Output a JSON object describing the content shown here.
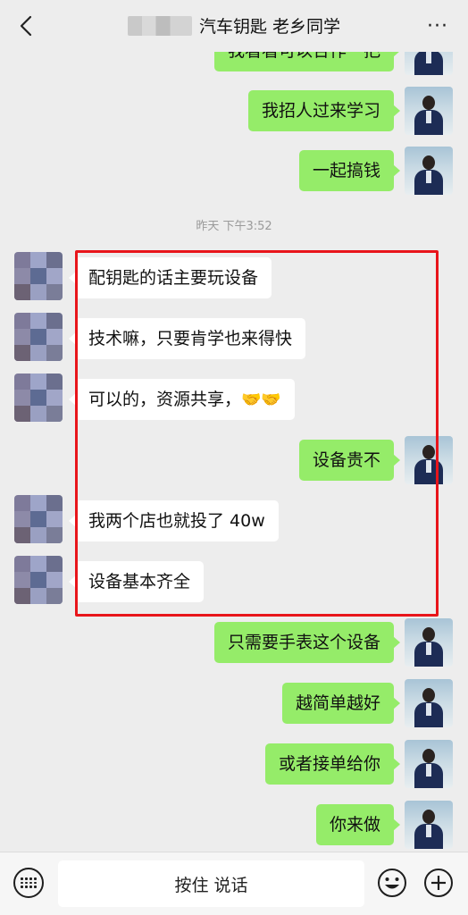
{
  "header": {
    "title": "汽车钥匙 老乡同学",
    "back_icon": "chevron-left-icon",
    "more_label": "···"
  },
  "messages": [
    {
      "side": "self",
      "text": "我看看可以合作一把",
      "partial": true
    },
    {
      "side": "self",
      "text": "我招人过来学习"
    },
    {
      "side": "self",
      "text": "一起搞钱"
    },
    {
      "side": "other",
      "text": "配钥匙的话主要玩设备"
    },
    {
      "side": "other",
      "text": "技术嘛，只要肯学也来得快"
    },
    {
      "side": "other",
      "text": "可以的，资源共享，",
      "emoji": "🤝🤝"
    },
    {
      "side": "self",
      "text": "设备贵不"
    },
    {
      "side": "other",
      "text": "我两个店也就投了 40w"
    },
    {
      "side": "other",
      "text": "设备基本齐全"
    },
    {
      "side": "self",
      "text": "只需要手表这个设备"
    },
    {
      "side": "self",
      "text": "越简单越好"
    },
    {
      "side": "self",
      "text": "或者接单给你"
    },
    {
      "side": "self",
      "text": "你来做"
    }
  ],
  "timestamp": "昨天 下午3:52",
  "input_bar": {
    "hold_to_talk": "按住 说话",
    "keyboard_icon": "keyboard-icon",
    "emoji_icon": "smiley-icon",
    "plus_icon": "plus-circle-icon"
  },
  "colors": {
    "outgoing_bubble": "#95ec69",
    "incoming_bubble": "#ffffff",
    "background": "#ededed",
    "highlight": "#e8151b"
  }
}
